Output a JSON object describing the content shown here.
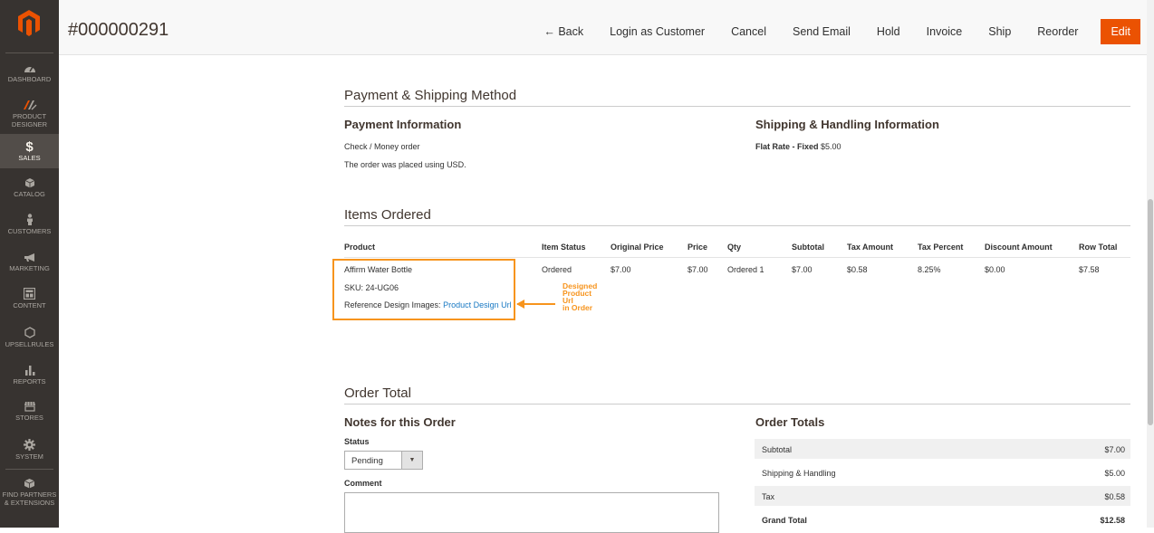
{
  "sidebar": {
    "items": [
      {
        "label": "DASHBOARD"
      },
      {
        "label1": "PRODUCT",
        "label2": "DESIGNER"
      },
      {
        "label": "SALES"
      },
      {
        "label": "CATALOG"
      },
      {
        "label": "CUSTOMERS"
      },
      {
        "label": "MARKETING"
      },
      {
        "label": "CONTENT"
      },
      {
        "label": "UPSELLRULES"
      },
      {
        "label": "REPORTS"
      },
      {
        "label": "STORES"
      },
      {
        "label": "SYSTEM"
      },
      {
        "label1": "FIND PARTNERS",
        "label2": "& EXTENSIONS"
      }
    ]
  },
  "header": {
    "order_number": "#000000291",
    "actions": [
      "← Back",
      "Login as Customer",
      "Cancel",
      "Send Email",
      "Hold",
      "Invoice",
      "Ship",
      "Reorder",
      "Edit"
    ]
  },
  "payment_shipping": {
    "title": "Payment & Shipping Method",
    "payment_heading": "Payment Information",
    "payment_method": "Check / Money order",
    "currency_note": "The order was placed using USD.",
    "shipping_heading": "Shipping & Handling Information",
    "shipping_method": "Flat Rate - Fixed",
    "shipping_price": "$5.00"
  },
  "items_ordered": {
    "title": "Items Ordered",
    "columns": [
      "Product",
      "Item Status",
      "Original Price",
      "Price",
      "Qty",
      "Subtotal",
      "Tax Amount",
      "Tax Percent",
      "Discount Amount",
      "Row Total"
    ],
    "row": {
      "product_name": "Affirm Water Bottle",
      "sku": "SKU: 24-UG06",
      "ref_label": "Reference Design Images:",
      "ref_link": "Product Design Url",
      "item_status": "Ordered",
      "original_price": "$7.00",
      "price": "$7.00",
      "qty": "Ordered 1",
      "subtotal": "$7.00",
      "tax_amount": "$0.58",
      "tax_percent": "8.25%",
      "discount_amount": "$0.00",
      "row_total": "$7.58"
    },
    "annotation": [
      "Designed",
      "Product",
      "Url",
      "in Order"
    ]
  },
  "order_total": {
    "title": "Order Total",
    "notes_heading": "Notes for this Order",
    "status_label": "Status",
    "status_value": "Pending",
    "comment_label": "Comment",
    "totals_heading": "Order Totals",
    "rows": [
      {
        "label": "Subtotal",
        "value": "$7.00"
      },
      {
        "label": "Shipping & Handling",
        "value": "$5.00"
      },
      {
        "label": "Tax",
        "value": "$0.58"
      },
      {
        "label": "Grand Total",
        "value": "$12.58"
      }
    ]
  },
  "colors": {
    "sidebar_bg": "#373330",
    "accent_orange": "#eb5202",
    "annotation_orange": "#f7941d",
    "link_blue": "#1979c3"
  }
}
